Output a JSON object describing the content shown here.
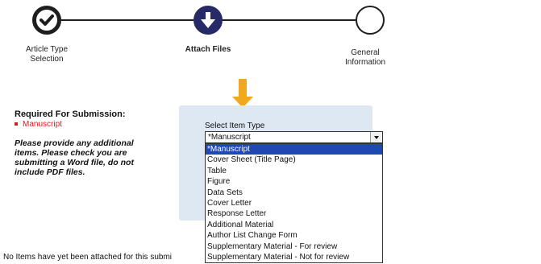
{
  "steps": [
    {
      "label_line1": "Article Type",
      "label_line2": "Selection",
      "state": "completed",
      "icon": "check-icon"
    },
    {
      "label_line1": "Attach Files",
      "label_line2": "",
      "state": "current",
      "icon": "arrow-down-icon"
    },
    {
      "label_line1": "General",
      "label_line2": "Information",
      "state": "todo",
      "icon": ""
    }
  ],
  "requirements": {
    "title": "Required For Submission:",
    "items": [
      "Manuscript"
    ],
    "note": [
      "Please provide any additional",
      "items. Please check you are",
      "submitting a Word file, do not",
      "include PDF files."
    ]
  },
  "item_type": {
    "label": "Select Item Type",
    "selected": "*Manuscript",
    "options": [
      "*Manuscript",
      "Cover Sheet (Title Page)",
      "Table",
      "Figure",
      "Data Sets",
      "Cover Letter",
      "Response Letter",
      "Additional Material",
      "Author List Change Form",
      "Supplementary Material - For review",
      "Supplementary Material - Not for review"
    ]
  },
  "status_message": "No Items have yet been attached for this submi",
  "colors": {
    "accent_arrow": "#f0a81f",
    "current_step": "#262a66",
    "required_red": "#d0201c",
    "selection_blue": "#1f49b2",
    "panel_bg": "#dde8f3"
  }
}
